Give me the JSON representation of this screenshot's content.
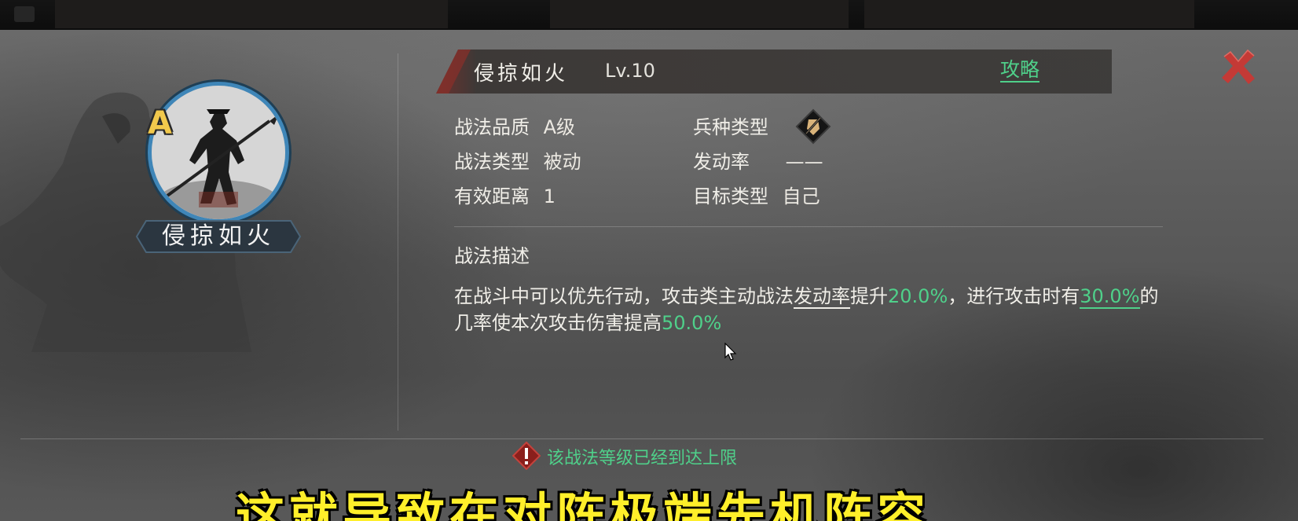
{
  "skill": {
    "name": "侵掠如火",
    "level": "Lv.10",
    "grade_letter": "A",
    "strategy_link": "攻略"
  },
  "attributes": {
    "quality_label": "战法品质",
    "quality_value": "A级",
    "type_label": "战法类型",
    "type_value": "被动",
    "range_label": "有效距离",
    "range_value": "1",
    "troop_label": "兵种类型",
    "troop_icon": "troop-type-icon",
    "rate_label": "发动率",
    "rate_value": "——",
    "target_label": "目标类型",
    "target_value": "自己"
  },
  "description": {
    "title": "战法描述",
    "p1": "在战斗中可以优先行动，攻击类主动战法",
    "p2": "发动率",
    "p3": "提升",
    "p4": "20.0%",
    "p5": "，进行攻击时有",
    "p6": "30.0%",
    "p7": "的几率使本次攻击伤害提高",
    "p8": "50.0%"
  },
  "notice": {
    "text": "该战法等级已经到达上限",
    "icon": "warning-icon"
  },
  "subtitle_overlay": "这就导致在对阵极端先机阵容",
  "colors": {
    "accent_green": "#4fd08a",
    "close_red": "#c43a36",
    "portrait_ring": "#3f86b8",
    "grade_gold": "#f2c94c"
  }
}
